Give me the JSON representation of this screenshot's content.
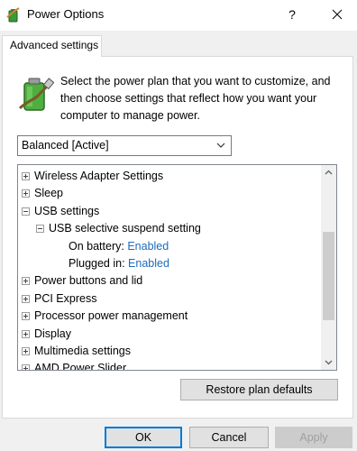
{
  "window": {
    "title": "Power Options",
    "help_label": "?",
    "icon": "power-options-icon",
    "close_icon": "close-icon"
  },
  "tab": {
    "label": "Advanced settings"
  },
  "description": "Select the power plan that you want to customize, and then choose settings that reflect how you want your computer to manage power.",
  "plan_select": {
    "selected": "Balanced [Active]"
  },
  "tree": {
    "rows": [
      {
        "label": "Wireless Adapter Settings",
        "expander": "plus",
        "level": 0
      },
      {
        "label": "Sleep",
        "expander": "plus",
        "level": 0
      },
      {
        "label": "USB settings",
        "expander": "minus",
        "level": 0
      },
      {
        "label": "USB selective suspend setting",
        "expander": "minus",
        "level": 1
      },
      {
        "label": "On battery:",
        "value": "Enabled",
        "expander": "none",
        "level": 2
      },
      {
        "label": "Plugged in:",
        "value": "Enabled",
        "expander": "none",
        "level": 2
      },
      {
        "label": "Power buttons and lid",
        "expander": "plus",
        "level": 0
      },
      {
        "label": "PCI Express",
        "expander": "plus",
        "level": 0
      },
      {
        "label": "Processor power management",
        "expander": "plus",
        "level": 0
      },
      {
        "label": "Display",
        "expander": "plus",
        "level": 0
      },
      {
        "label": "Multimedia settings",
        "expander": "plus",
        "level": 0
      },
      {
        "label": "AMD Power Slider",
        "expander": "plus",
        "level": 0
      }
    ]
  },
  "buttons": {
    "restore": "Restore plan defaults",
    "ok": "OK",
    "cancel": "Cancel",
    "apply": "Apply"
  },
  "colors": {
    "value_link": "#1f6bbd",
    "focus_border": "#0078d7"
  }
}
